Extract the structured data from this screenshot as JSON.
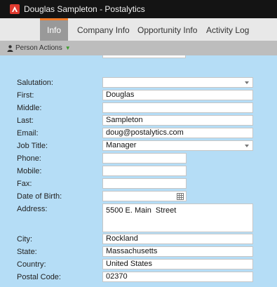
{
  "window": {
    "title": "Douglas Sampleton - Postalytics"
  },
  "tabs": [
    {
      "label": "Info"
    },
    {
      "label": "Company Info"
    },
    {
      "label": "Opportunity Info"
    },
    {
      "label": "Activity Log"
    }
  ],
  "actions": {
    "person_actions_label": "Person Actions"
  },
  "form": {
    "salutation": {
      "label": "Salutation:",
      "value": ""
    },
    "first": {
      "label": "First:",
      "value": "Douglas"
    },
    "middle": {
      "label": "Middle:",
      "value": ""
    },
    "last": {
      "label": "Last:",
      "value": "Sampleton"
    },
    "email": {
      "label": "Email:",
      "value": "doug@postalytics.com"
    },
    "job_title": {
      "label": "Job Title:",
      "value": "Manager"
    },
    "phone": {
      "label": "Phone:",
      "value": ""
    },
    "mobile": {
      "label": "Mobile:",
      "value": ""
    },
    "fax": {
      "label": "Fax:",
      "value": ""
    },
    "dob": {
      "label": "Date of Birth:",
      "value": ""
    },
    "address": {
      "label": "Address:",
      "value": "5500 E. Main  Street"
    },
    "city": {
      "label": "City:",
      "value": "Rockland"
    },
    "state": {
      "label": "State:",
      "value": "Massachusetts"
    },
    "country": {
      "label": "Country:",
      "value": "United States"
    },
    "postal_code": {
      "label": "Postal Code:",
      "value": "02370"
    }
  },
  "colors": {
    "accent": "#f27d2b",
    "form_bg": "#b5ddf6",
    "logo": "#e03a2f",
    "titlebar": "#141414"
  },
  "icons": {
    "logo": "postalytics-logo-icon",
    "person": "person-icon",
    "caret": "caret-down-icon",
    "calendar": "calendar-icon",
    "select": "select-arrow-icon"
  }
}
